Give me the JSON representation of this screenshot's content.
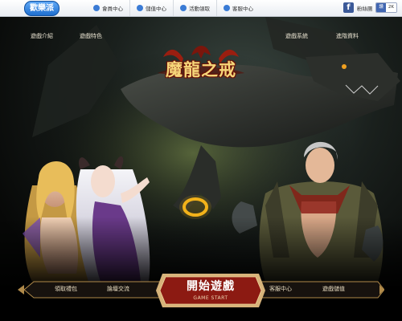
{
  "topbar": {
    "logo": "歡樂派",
    "nav": [
      {
        "label": "會員中心",
        "icon": "user-icon"
      },
      {
        "label": "儲值中心",
        "icon": "coin-icon"
      },
      {
        "label": "活動領取",
        "icon": "headset-icon"
      },
      {
        "label": "客服中心",
        "icon": "chat-icon"
      }
    ],
    "fb_label": "粉絲團",
    "like": {
      "label": "讚",
      "count": "2K"
    }
  },
  "game": {
    "logo_text": "魔龍之戒"
  },
  "menu": {
    "left": [
      "遊戲介紹",
      "遊戲特色"
    ],
    "right": [
      "遊戲系統",
      "進階資料"
    ]
  },
  "bottom": {
    "gift": "領取禮包",
    "forum": "論壇交流",
    "start_title": "開始遊戲",
    "start_sub": "GAME START",
    "support": "客服中心",
    "topup": "遊戲儲值"
  },
  "colors": {
    "accent_gold": "#d8b46a",
    "start_red": "#8c1a12",
    "nav_blue": "#3a7bd5"
  }
}
